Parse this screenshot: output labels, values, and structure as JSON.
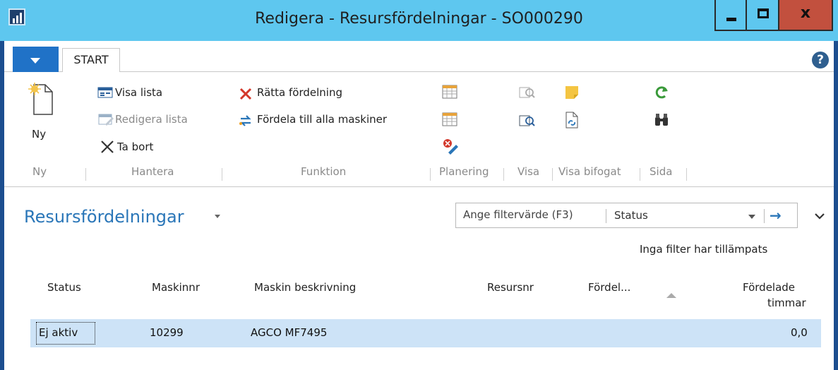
{
  "window": {
    "title": "Redigera - Resursfördelningar - SO000290",
    "close_label": "x"
  },
  "ribbon": {
    "tab_start": "START",
    "help_glyph": "?",
    "new_label": "Ny",
    "show_list": "Visa lista",
    "edit_list": "Redigera lista",
    "delete": "Ta bort",
    "correct_allocation": "Rätta fördelning",
    "allocate_all": "Fördela till alla maskiner",
    "groups": [
      "Ny",
      "Hantera",
      "Funktion",
      "Planering",
      "Visa",
      "Visa bifogat",
      "Sida"
    ]
  },
  "section": {
    "title": "Resursfördelningar",
    "filter_placeholder": "Ange filtervärde (F3)",
    "filter_field": "Status",
    "no_filter_text": "Inga filter har tillämpats"
  },
  "table": {
    "headers": [
      "Status",
      "Maskinnr",
      "Maskin beskrivning",
      "Resursnr",
      "Fördel...",
      "Fördelade",
      "timmar"
    ],
    "row": {
      "status": "Ej aktiv",
      "machine_no": "10299",
      "description": "AGCO MF7495",
      "resource_no": "",
      "allocated_hours": "0,0"
    }
  },
  "colors": {
    "title_bar": "#5ec7ef",
    "frame": "#1c4e8f",
    "accent": "#2a76b8",
    "selected_row": "#cde3f7",
    "close_button": "#c2503e"
  }
}
